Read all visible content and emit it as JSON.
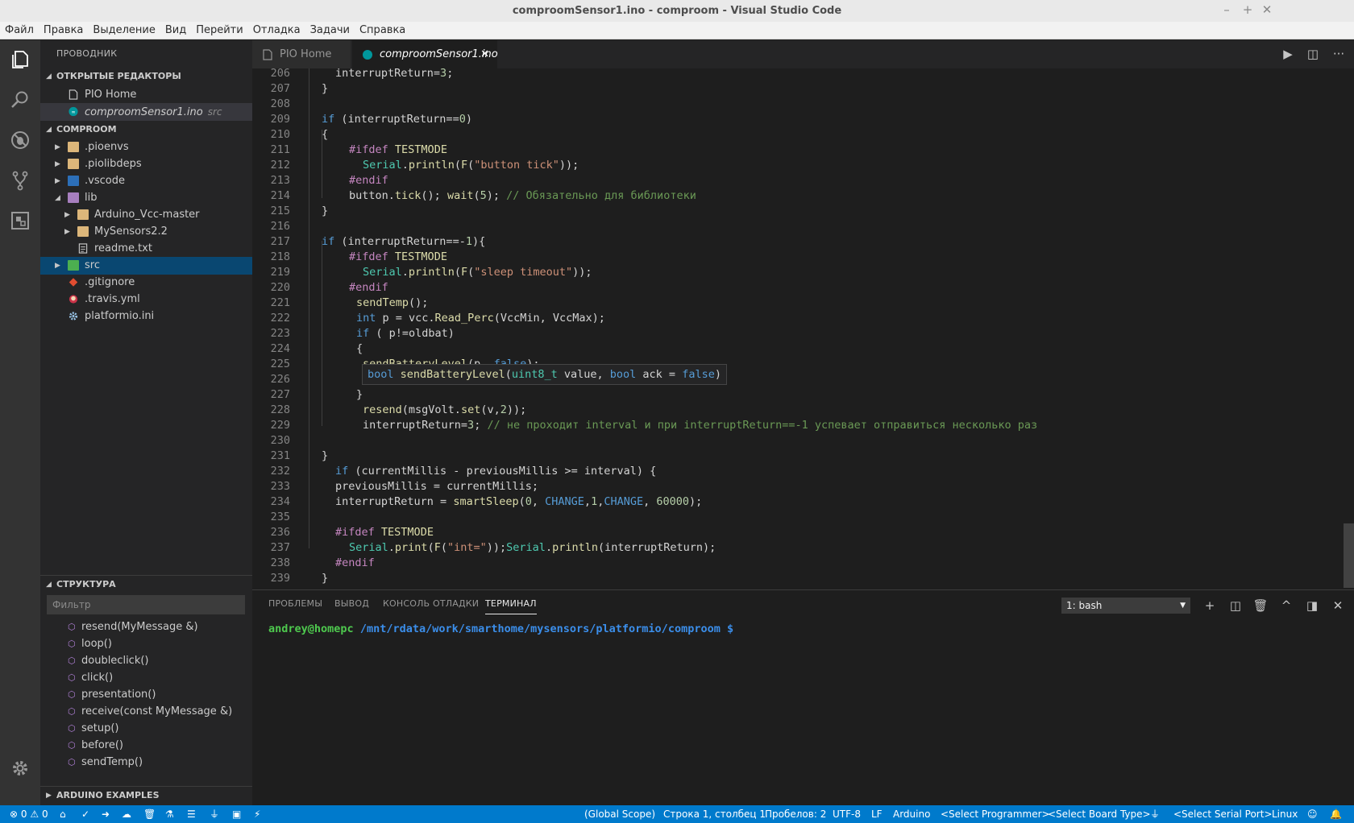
{
  "window": {
    "title": "comproomSensor1.ino - comproom - Visual Studio Code",
    "controls": [
      "–",
      "+",
      "✕"
    ]
  },
  "menu": [
    "Файл",
    "Правка",
    "Выделение",
    "Вид",
    "Перейти",
    "Отладка",
    "Задачи",
    "Справка"
  ],
  "activity_bar": {
    "icons": [
      "explorer-icon",
      "search-icon",
      "debug-icon",
      "source-control-icon",
      "extensions-icon",
      "settings-gear-icon"
    ]
  },
  "sidebar": {
    "header": "ПРОВОДНИК",
    "open_editors": {
      "title": "ОТКРЫТЫЕ РЕДАКТОРЫ",
      "items": [
        {
          "label": "PIO Home",
          "desc": ""
        },
        {
          "label": "comproomSensor1.ino",
          "desc": "src"
        }
      ]
    },
    "project": {
      "title": "COMPROOM",
      "items": [
        {
          "label": ".pioenvs",
          "kind": "folder"
        },
        {
          "label": ".piolibdeps",
          "kind": "folder"
        },
        {
          "label": ".vscode",
          "kind": "folder"
        },
        {
          "label": "lib",
          "kind": "folder"
        },
        {
          "label": "Arduino_Vcc-master",
          "kind": "folder"
        },
        {
          "label": "MySensors2.2",
          "kind": "folder"
        },
        {
          "label": "readme.txt",
          "kind": "file"
        },
        {
          "label": "src",
          "kind": "folder"
        },
        {
          "label": ".gitignore",
          "kind": "file"
        },
        {
          "label": ".travis.yml",
          "kind": "file"
        },
        {
          "label": "platformio.ini",
          "kind": "file"
        }
      ]
    },
    "outline": {
      "title": "СТРУКТУРА",
      "filter_placeholder": "Фильтр",
      "items": [
        "resend(MyMessage &)",
        "loop()",
        "doubleclick()",
        "click()",
        "presentation()",
        "receive(const MyMessage &)",
        "setup()",
        "before()",
        "sendTemp()"
      ]
    },
    "arduino_examples": "ARDUINO EXAMPLES"
  },
  "editor": {
    "tabs": [
      {
        "label": "PIO Home",
        "active": false
      },
      {
        "label": "comproomSensor1.ino",
        "active": true,
        "close": "✕"
      }
    ],
    "actions": [
      "▶",
      "◫",
      "···"
    ],
    "hover_signature": "bool sendBatteryLevel(uint8_t value, bool ack = false)"
  },
  "panel": {
    "tabs": [
      "ПРОБЛЕМЫ",
      "ВЫВОД",
      "КОНСОЛЬ ОТЛАДКИ",
      "ТЕРМИНАЛ"
    ],
    "terminal_select": "1: bash",
    "actions": [
      "+",
      "◫",
      "🗑",
      "^",
      "◨",
      "✕"
    ],
    "prompt_user": "andrey@homepc",
    "prompt_path": "/mnt/rdata/work/smarthome/mysensors/platformio/comproom $"
  },
  "status_bar": {
    "errors": "0",
    "warnings": "0",
    "scope": "(Global Scope)",
    "position": "Строка 1, столбец 1",
    "spaces": "Пробелов: 2",
    "encoding": "UTF-8",
    "eol": "LF",
    "language": "Arduino",
    "programmer": "<Select Programmer>",
    "board": "<Select Board Type>",
    "serial": "<Select Serial Port>",
    "os": "Linux"
  }
}
